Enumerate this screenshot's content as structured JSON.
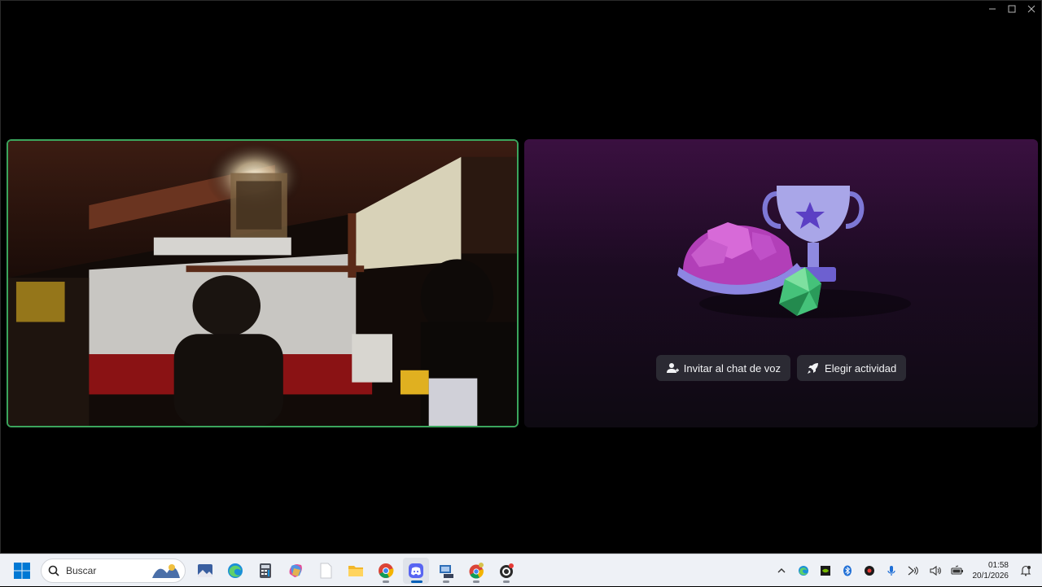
{
  "window": {
    "controls": [
      "minimize-icon",
      "maximize-icon",
      "close-icon"
    ]
  },
  "activity": {
    "invite_label": "Invitar al chat de voz",
    "choose_label": "Elegir actividad",
    "colors": {
      "button_bg": "#2b2a33",
      "speaking_border": "#3ba55d"
    }
  },
  "taskbar": {
    "search_placeholder": "Buscar",
    "apps": [
      "windows-start-icon",
      "weather-widget-icon",
      "photos-icon",
      "edge-icon",
      "calculator-icon",
      "copilot-icon",
      "notepad-icon",
      "file-explorer-icon",
      "chrome-icon",
      "discord-icon",
      "network-app-icon",
      "chrome-profile-icon",
      "obs-icon"
    ],
    "tray": [
      "chevron-up-icon",
      "edge-tray-icon",
      "nvidia-icon",
      "bluetooth-icon",
      "app-tray-icon",
      "microphone-icon",
      "network-icon",
      "volume-icon",
      "battery-icon"
    ],
    "time": "01:58",
    "date": "20/1/2026"
  }
}
